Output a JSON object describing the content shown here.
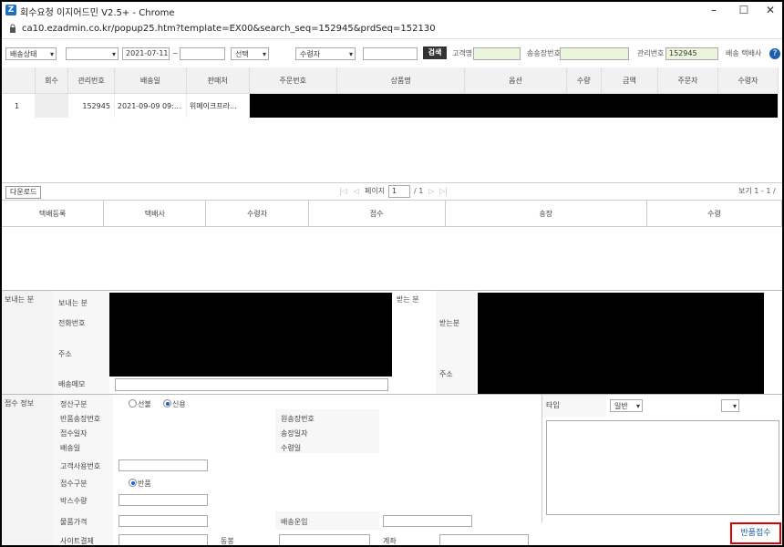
{
  "window": {
    "title": "회수요청 이지어드민 V2.5+ - Chrome",
    "url": "ca10.ezadmin.co.kr/popup25.htm?template=EX00&search_seq=152945&prdSeq=152130",
    "controls": [
      "–",
      "☐",
      "✕"
    ]
  },
  "filter": {
    "status_select": "배송상태",
    "blank_select": "",
    "date_from": "2021-07-11",
    "tilde": "~",
    "date_to": "",
    "choice_select": "선택",
    "receiver_select": "수령자",
    "search_text": "",
    "search_button": "검색",
    "customer_label": "고객명",
    "customer_value": "",
    "invoice_label": "송송장번호",
    "invoice_value": "",
    "mgmt_label": "관리번호",
    "mgmt_value": "152945",
    "courier_label": "배송 택배사",
    "help": "?"
  },
  "grid": {
    "columns": [
      "",
      "회수",
      "관리번호",
      "배송일",
      "판매처",
      "주문번호",
      "상품명",
      "옵션",
      "수량",
      "금액",
      "주문자",
      "수령자"
    ],
    "rows": [
      {
        "no": "1",
        "return": "",
        "mgmt": "152945",
        "ship_date": "2021-09-09 09:...",
        "seller": "위메이크프라..."
      }
    ]
  },
  "pager": {
    "download": "다운로드",
    "nav_first": "|◁",
    "nav_prev": "◁",
    "page_label": "페이지",
    "page_value": "1",
    "of": "/ 1",
    "nav_next": "▷",
    "nav_last": "▷|",
    "view": "보기 1 - 1 /"
  },
  "grid2": {
    "columns": [
      "택배등록",
      "택배사",
      "수령자",
      "접수",
      "송장",
      "수령"
    ]
  },
  "sender": {
    "section": "보내는 분",
    "name_label": "보내는 분",
    "phone_label": "전화번호",
    "address_label": "주소",
    "memo_label": "배송메모"
  },
  "receiver": {
    "section": "받는 분",
    "name_label": "받는분",
    "address_label": "주소"
  },
  "intake": {
    "section": "접수 정보",
    "settle_label": "정산구분",
    "settle_opt1": "선불",
    "settle_opt2": "신용",
    "return_invoice": "반품송장번호",
    "orig_invoice": "원송장번호",
    "intake_date": "접수일자",
    "invoice_date": "송장일자",
    "ship_date": "배송일",
    "recv_date": "수령일",
    "cust_no": "고객사용번호",
    "intake_type": "접수구분",
    "intake_type_opt": "반품",
    "box_qty": "박스수량",
    "item_price": "물품가격",
    "ship_fee": "배송운임",
    "site_pay": "사이트결제",
    "bundle": "동봉",
    "account": "계좌"
  },
  "type_panel": {
    "label": "타입",
    "type_select": "일반",
    "second_select": ""
  },
  "submit_button": "반품접수"
}
